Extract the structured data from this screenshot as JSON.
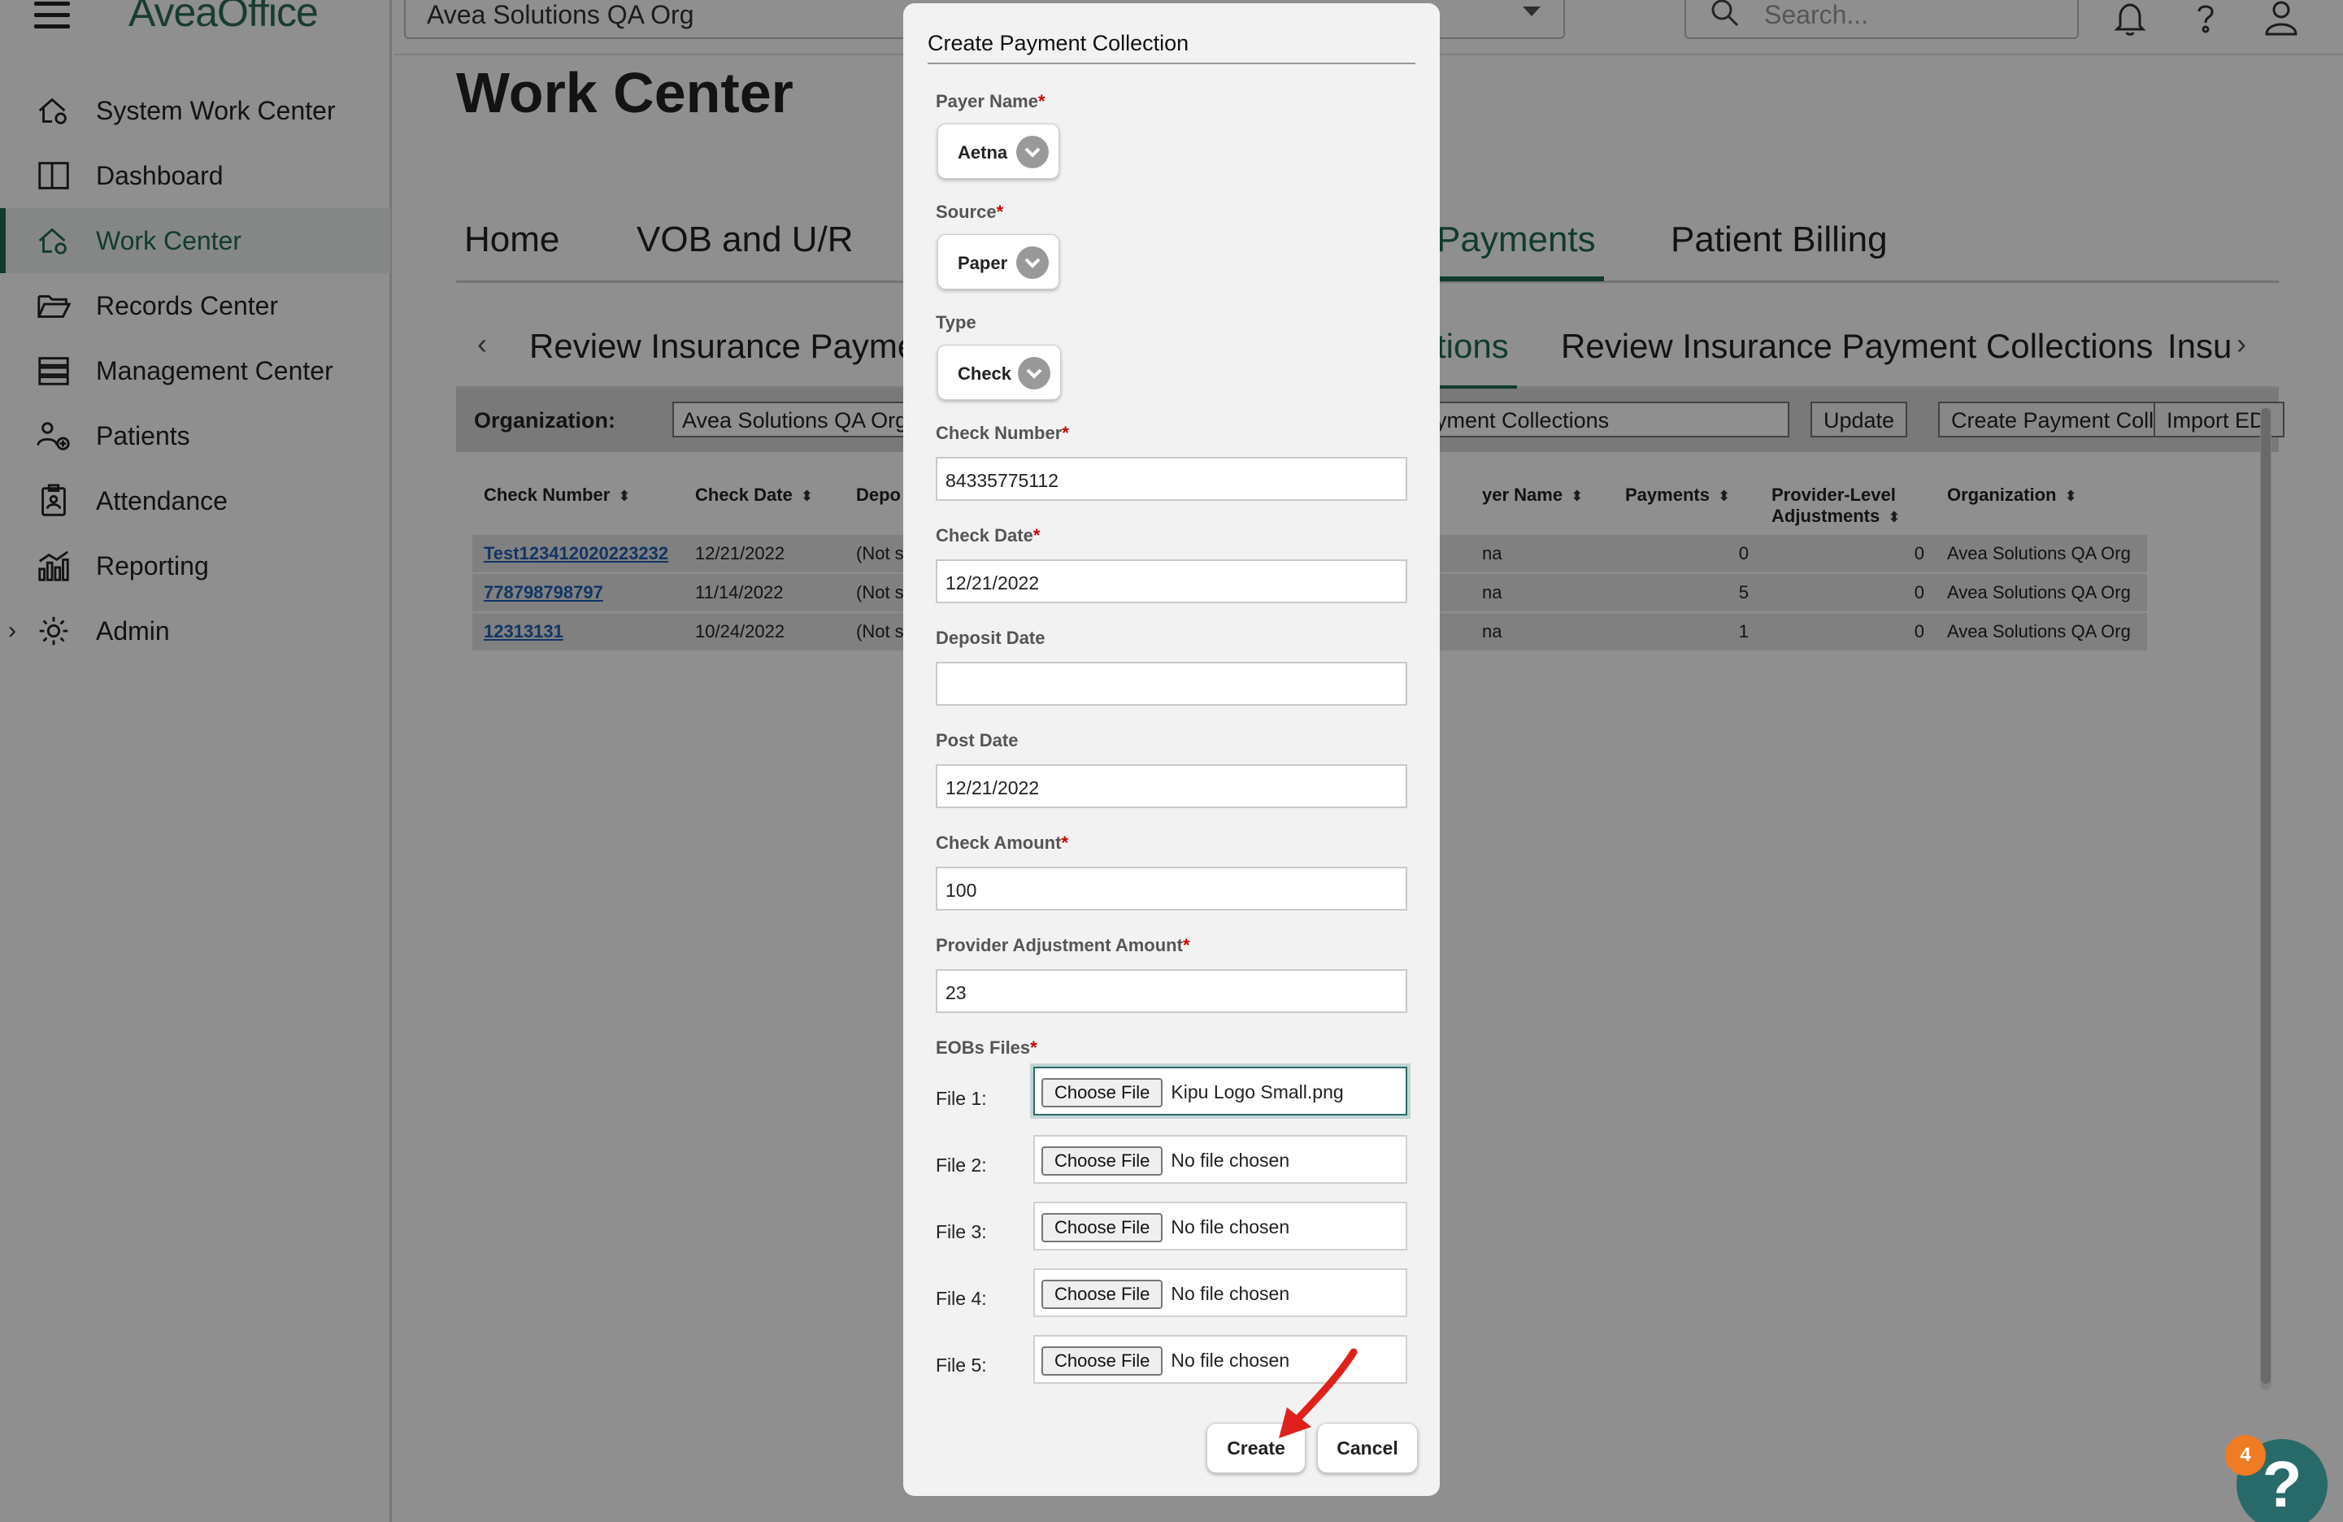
{
  "app": {
    "brand": "AveaOffice"
  },
  "topbar": {
    "org_selected": "Avea Solutions QA Org",
    "search_placeholder": "Search..."
  },
  "sidebar": {
    "items": [
      {
        "label": "System Work Center",
        "icon": "house-gear-icon"
      },
      {
        "label": "Dashboard",
        "icon": "columns-icon"
      },
      {
        "label": "Work Center",
        "icon": "house-gear-icon",
        "active": true
      },
      {
        "label": "Records Center",
        "icon": "folder-open-icon"
      },
      {
        "label": "Management Center",
        "icon": "server-icon"
      },
      {
        "label": "Patients",
        "icon": "users-add-icon"
      },
      {
        "label": "Attendance",
        "icon": "clipboard-user-icon"
      },
      {
        "label": "Reporting",
        "icon": "bar-chart-icon"
      },
      {
        "label": "Admin",
        "icon": "gear-icon"
      }
    ]
  },
  "main": {
    "title": "Work Center",
    "tabs": [
      "Home",
      "VOB and U/R",
      "Payments",
      "Patient Billing"
    ],
    "sub_tabs": [
      "Review Insurance Payment",
      "tions",
      "Review Insurance Payment Collections",
      "Insu"
    ],
    "filter": {
      "org_label": "Organization:",
      "org_value": "Avea Solutions QA Org",
      "view_value": "ayment Collections",
      "update_label": "Update",
      "create_label": "Create Payment Collection",
      "import_label": "Import EDI"
    },
    "table": {
      "headers": [
        "Check Number",
        "Check Date",
        "Depo",
        "yer Name",
        "Payments",
        "Provider-Level Adjustments",
        "Organization"
      ],
      "rows": [
        [
          "Test123412020223232",
          "12/21/2022",
          "(Not s",
          "na",
          "0",
          "0",
          "Avea Solutions QA Org"
        ],
        [
          "778798798797",
          "11/14/2022",
          "(Not s",
          "na",
          "5",
          "0",
          "Avea Solutions QA Org"
        ],
        [
          "12313131",
          "10/24/2022",
          "(Not s",
          "na",
          "1",
          "0",
          "Avea Solutions QA Org"
        ]
      ]
    }
  },
  "modal": {
    "title": "Create Payment Collection",
    "payer_name_label": "Payer Name",
    "payer_name_value": "Aetna",
    "source_label": "Source",
    "source_value": "Paper",
    "type_label": "Type",
    "type_value": "Check",
    "check_number_label": "Check Number",
    "check_number_value": "84335775112",
    "check_date_label": "Check Date",
    "check_date_value": "12/21/2022",
    "deposit_date_label": "Deposit Date",
    "deposit_date_value": "",
    "post_date_label": "Post Date",
    "post_date_value": "12/21/2022",
    "check_amount_label": "Check Amount",
    "check_amount_value": "100",
    "provider_adj_label": "Provider Adjustment Amount",
    "provider_adj_value": "23",
    "eobs_label": "EOBs Files",
    "required_mark": "*",
    "choose_file_label": "Choose File",
    "files": [
      {
        "label": "File 1:",
        "status": "Kipu Logo Small.png"
      },
      {
        "label": "File 2:",
        "status": "No file chosen"
      },
      {
        "label": "File 3:",
        "status": "No file chosen"
      },
      {
        "label": "File 4:",
        "status": "No file chosen"
      },
      {
        "label": "File 5:",
        "status": "No file chosen"
      }
    ],
    "create_label": "Create",
    "cancel_label": "Cancel"
  },
  "help": {
    "badge_count": "4",
    "glyph": "?"
  },
  "colors": {
    "brand_green": "#1f6a56",
    "annotation_red": "#e0201b",
    "help_teal": "#286a6a",
    "badge_orange": "#ef7b22"
  }
}
